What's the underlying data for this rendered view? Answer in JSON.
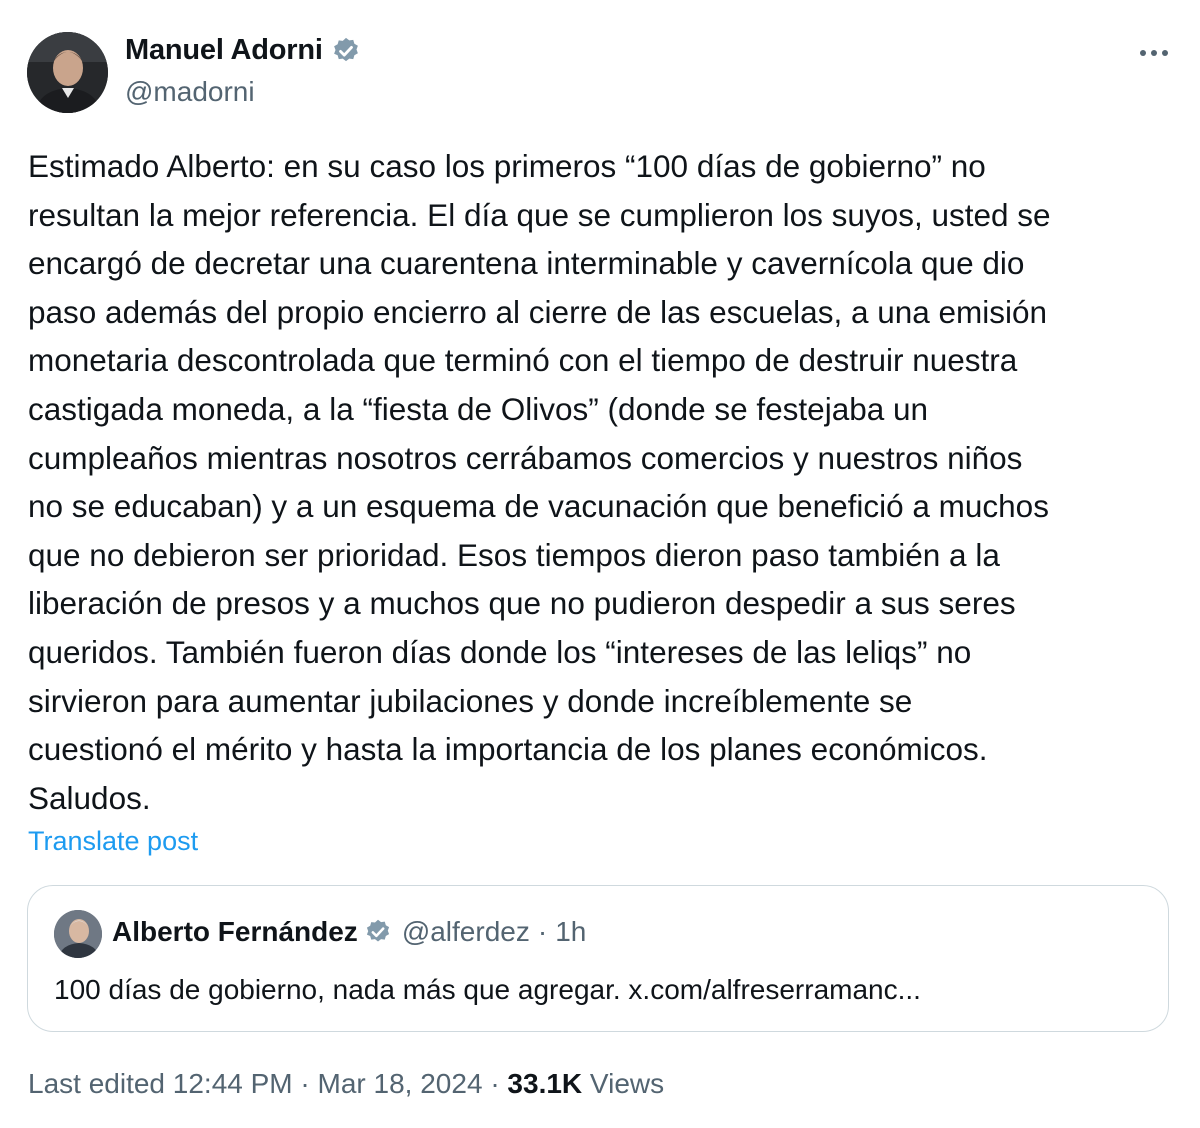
{
  "author": {
    "name": "Manuel Adorni",
    "handle": "@madorni",
    "verified_color": "#829aab"
  },
  "post": {
    "lines": [
      "Estimado Alberto: en su caso los primeros “100 días de gobierno” no",
      "resultan la mejor referencia. El día que se cumplieron los suyos, usted se",
      "encargó de decretar una cuarentena interminable y cavernícola que dio",
      "paso además del propio encierro al cierre de las escuelas, a una emisión",
      "monetaria descontrolada que terminó con el tiempo de destruir nuestra",
      "castigada moneda, a la “fiesta de Olivos” (donde se festejaba un",
      "cumpleaños mientras nosotros cerrábamos comercios y nuestros niños",
      "no se educaban) y a un esquema de vacunación que benefició a muchos",
      "que no debieron ser prioridad. Esos tiempos dieron paso también a la",
      "liberación de presos y a muchos que no pudieron despedir a sus seres",
      "queridos. También fueron días donde los “intereses de las leliqs” no",
      "sirvieron para aumentar jubilaciones y donde increíblemente se",
      "cuestionó el mérito y hasta la importancia de los planes económicos.",
      "Saludos."
    ],
    "translate_label": "Translate post"
  },
  "quote": {
    "name": "Alberto Fernández",
    "handle": "@alferdez",
    "separator": "·",
    "time": "1h",
    "text": "100 días de gobierno, nada más que agregar. x.com/alfreserramanc..."
  },
  "footer": {
    "edited_label": "Last edited",
    "time": "12:44 PM",
    "separator": "·",
    "date": "Mar 18, 2024",
    "views_count": "33.1K",
    "views_label": "Views"
  },
  "icons": {
    "more": "more-horizontal-icon",
    "verified": "verified-badge-icon"
  },
  "colors": {
    "text": "#0f1419",
    "secondary": "#536471",
    "link": "#1d9bf0",
    "border": "#cfd9de"
  }
}
